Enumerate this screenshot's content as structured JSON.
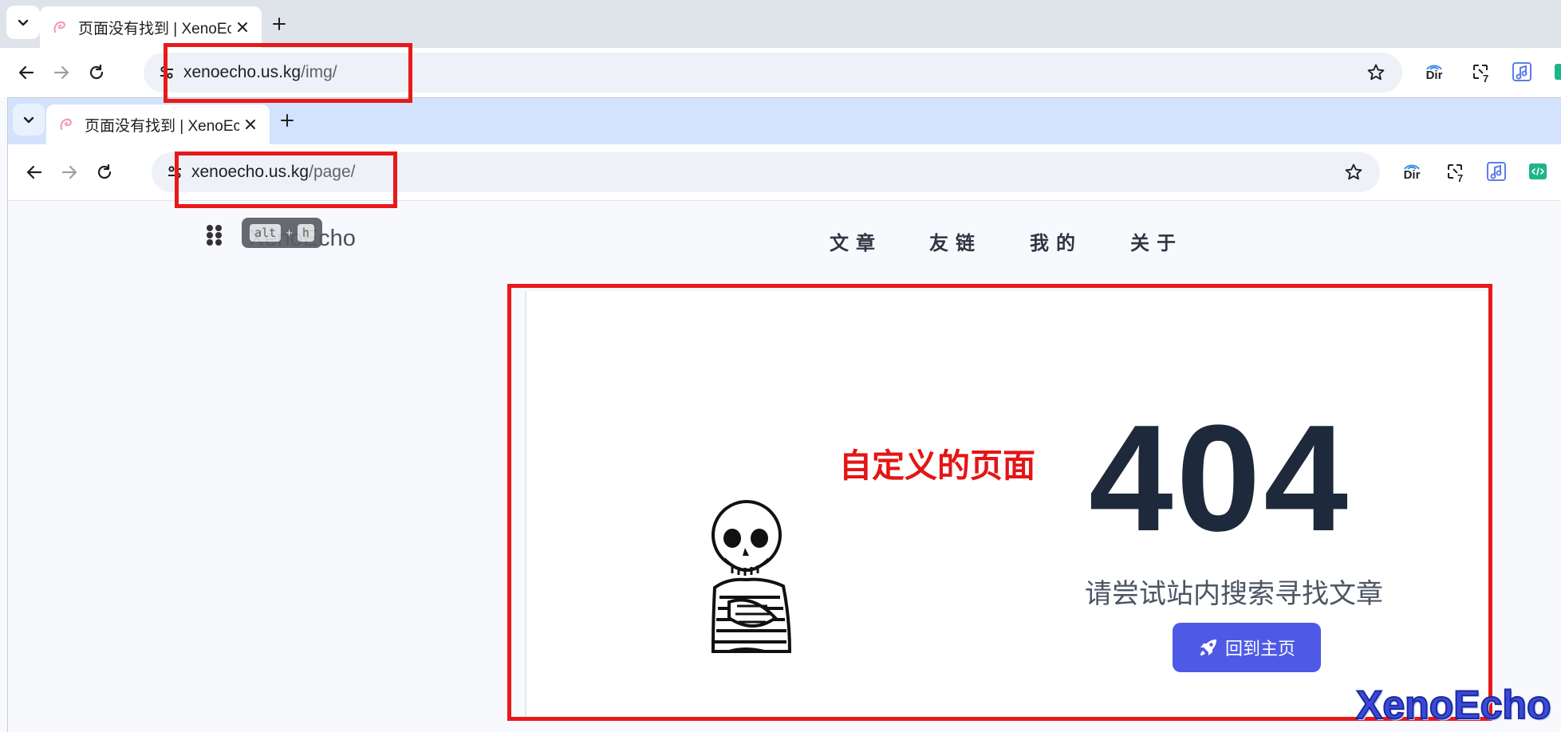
{
  "outer_browser": {
    "tab": {
      "title": "页面没有找到 | XenoEcho"
    },
    "address": {
      "host": "xenoecho.us.kg",
      "path": "/img/"
    },
    "extensions": {
      "dir_label": "Dir",
      "badge": "7"
    }
  },
  "inner_browser": {
    "tab": {
      "title": "页面没有找到 | XenoEcho"
    },
    "address": {
      "host": "xenoecho.us.kg",
      "path": "/page/"
    },
    "extensions": {
      "dir_label": "Dir",
      "badge": "7"
    }
  },
  "site": {
    "logo": "XenoEcho",
    "shortcut_hint": {
      "key1": "alt",
      "plus": "+",
      "key2": "h"
    },
    "nav": [
      "文章",
      "友链",
      "我的",
      "关于"
    ]
  },
  "error_page": {
    "annotation": "自定义的页面",
    "code": "404",
    "tip": "请尝试站内搜索寻找文章",
    "home_button": "回到主页"
  },
  "watermark": "XenoEcho",
  "colors": {
    "annotation_red": "#e8191a",
    "button_blue": "#4e5ae6",
    "code_dark": "#1e293b",
    "inner_tabstrip": "#d3e3fd",
    "outer_tabstrip": "#dfe3ea"
  }
}
